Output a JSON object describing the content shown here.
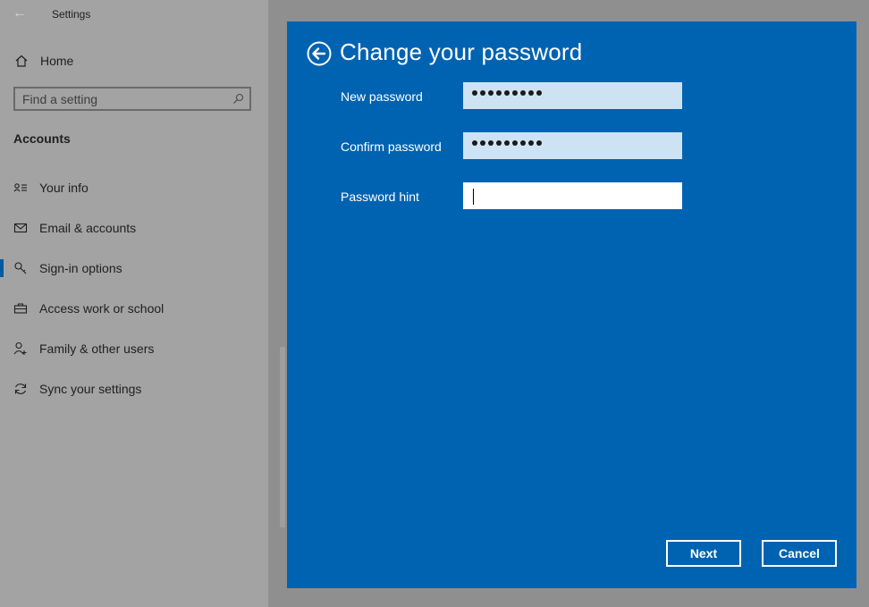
{
  "window": {
    "title": "Settings"
  },
  "sidebar": {
    "home_label": "Home",
    "search_placeholder": "Find a setting",
    "section_title": "Accounts",
    "items": [
      {
        "label": "Your info",
        "icon": "person-card-icon"
      },
      {
        "label": "Email & accounts",
        "icon": "envelope-icon"
      },
      {
        "label": "Sign-in options",
        "icon": "key-icon",
        "selected": true
      },
      {
        "label": "Access work or school",
        "icon": "briefcase-icon"
      },
      {
        "label": "Family & other users",
        "icon": "person-add-icon"
      },
      {
        "label": "Sync your settings",
        "icon": "sync-icon"
      }
    ]
  },
  "dialog": {
    "title": "Change your password",
    "fields": [
      {
        "label": "New password",
        "value": "●●●●●●●●●",
        "filled": true
      },
      {
        "label": "Confirm password",
        "value": "●●●●●●●●●",
        "filled": true
      },
      {
        "label": "Password hint",
        "value": "",
        "filled": false
      }
    ],
    "next_label": "Next",
    "cancel_label": "Cancel"
  },
  "colors": {
    "dialog_bg": "#0063b1",
    "accent": "#005a9e",
    "filled_field": "#cde3f3"
  }
}
